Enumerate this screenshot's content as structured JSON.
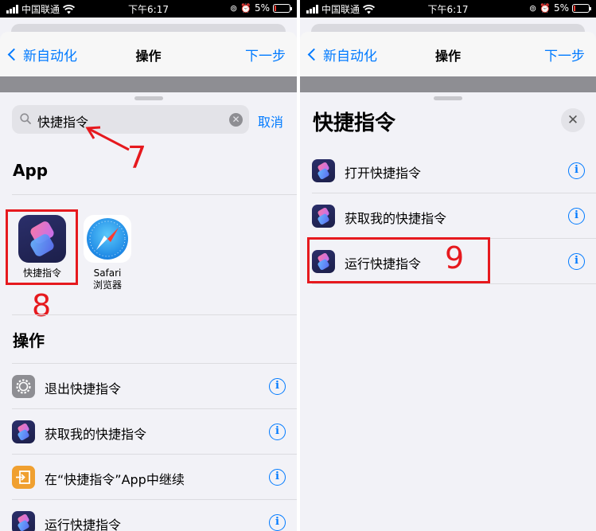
{
  "status": {
    "carrier": "中国联通",
    "time": "下午6:17",
    "battery_percent": "5%",
    "battery_level": 0.05
  },
  "nav": {
    "back_label": "新自动化",
    "title": "操作",
    "next_label": "下一步"
  },
  "left": {
    "search": {
      "value": "快捷指令",
      "cancel_label": "取消"
    },
    "app_section_title": "App",
    "apps": [
      {
        "label": "快捷指令",
        "icon": "shortcuts-app-icon"
      },
      {
        "label": "Safari\n浏览器",
        "label_line1": "Safari",
        "label_line2": "浏览器",
        "icon": "safari-app-icon"
      }
    ],
    "actions_section_title": "操作",
    "actions": [
      {
        "label": "退出快捷指令",
        "icon": "gear-icon"
      },
      {
        "label": "获取我的快捷指令",
        "icon": "shortcuts-icon"
      },
      {
        "label": "在“快捷指令”App中继续",
        "icon": "continue-in-app-icon"
      },
      {
        "label": "运行快捷指令",
        "icon": "shortcuts-icon"
      }
    ]
  },
  "right": {
    "title": "快捷指令",
    "close_label": "✕",
    "actions": [
      {
        "label": "打开快捷指令",
        "icon": "shortcuts-icon"
      },
      {
        "label": "获取我的快捷指令",
        "icon": "shortcuts-icon"
      },
      {
        "label": "运行快捷指令",
        "icon": "shortcuts-icon"
      }
    ]
  },
  "annotations": {
    "step7": "7",
    "step8": "8",
    "step9": "9",
    "color": "#e6191e"
  },
  "colors": {
    "accent": "#007aff",
    "background": "#f2f2f7"
  },
  "info_glyph": "i",
  "clear_glyph": "✕"
}
